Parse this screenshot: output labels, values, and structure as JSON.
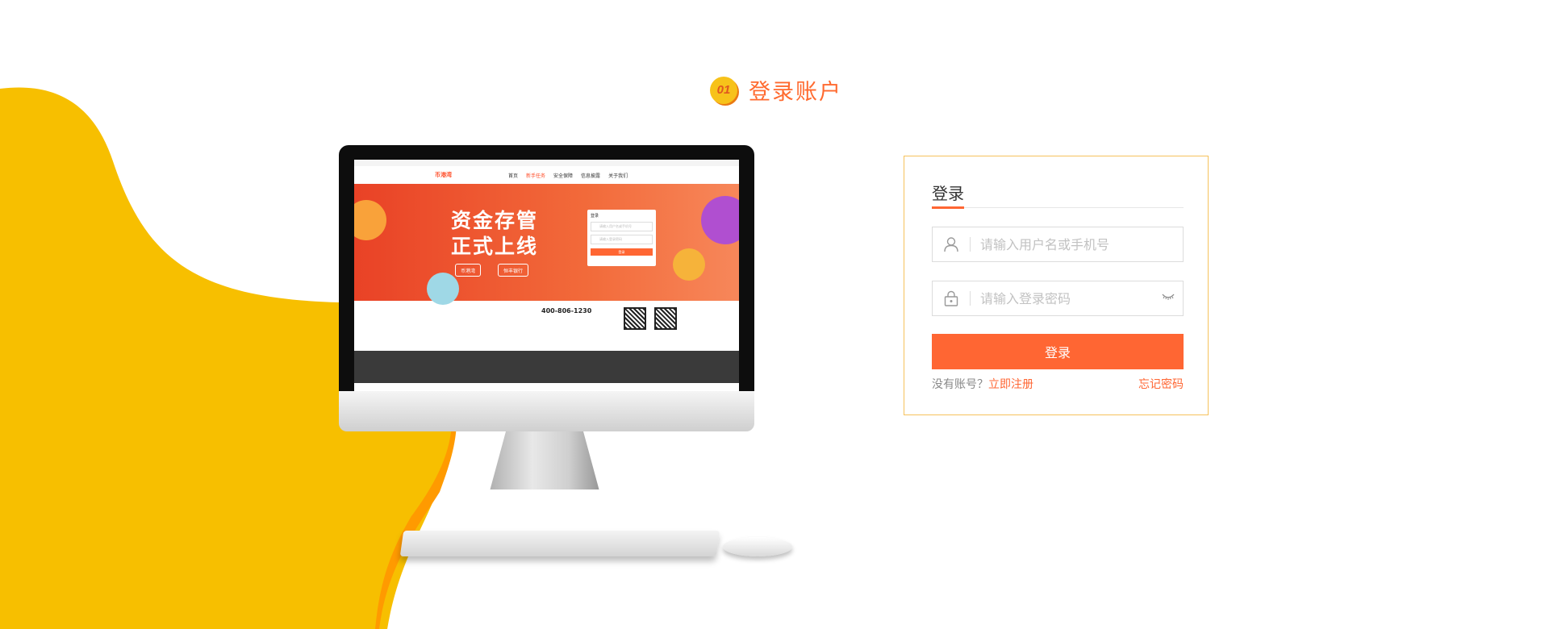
{
  "step": {
    "number": "01",
    "title": "登录账户"
  },
  "colors": {
    "accent": "#ff6633",
    "yellow": "#f7c21a",
    "panel_border": "#f6c25c"
  },
  "mockup": {
    "brand": "币港湾",
    "nav_items": [
      "首页",
      "新手任务",
      "安全保障",
      "信息披露",
      "关于我们"
    ],
    "banner_line1": "资金存管",
    "banner_line2": "正式上线",
    "partner_1": "币港湾",
    "partner_2": "恒丰银行",
    "login_title": "登录",
    "login_field_1": "请输入用户名或手机号",
    "login_field_2": "请输入登录密码",
    "login_button": "登录",
    "phone": "400-806-1230"
  },
  "login": {
    "title": "登录",
    "username_placeholder": "请输入用户名或手机号",
    "password_placeholder": "请输入登录密码",
    "submit_label": "登录",
    "no_account_text": "没有账号？",
    "register_link": "立即注册",
    "forgot_link": "忘记密码"
  },
  "icons": {
    "user": "user-icon",
    "lock": "lock-icon",
    "eye": "eye-closed-icon"
  }
}
